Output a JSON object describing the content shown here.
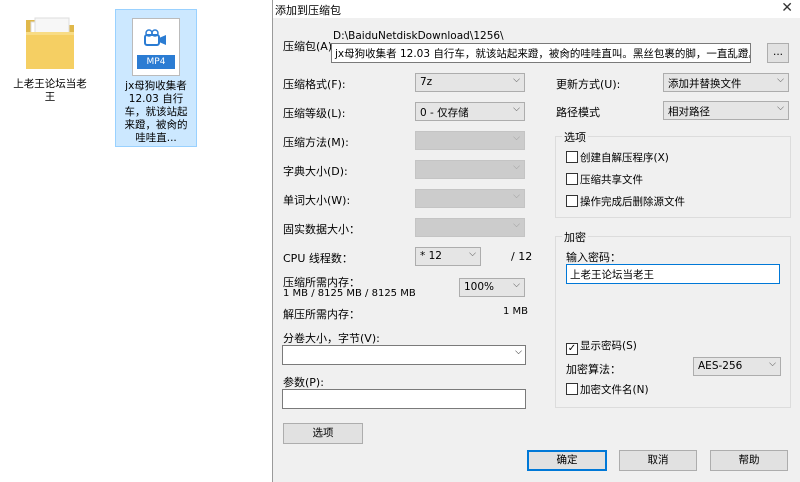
{
  "desktop": {
    "folder": {
      "label": "上老王论坛当老王"
    },
    "mp4": {
      "badge": "MP4",
      "label": "jx母狗收集者 12.03 自行车，就该站起来蹬，被肏的哇哇直..."
    }
  },
  "dialog": {
    "title": "添加到压缩包",
    "archive_label": "压缩包(A)",
    "archive_path": "D:\\BaiduNetdiskDownload\\1256\\",
    "archive_name": "jx母狗收集者 12.03 自行车，就该站起来蹬，被肏的哇哇直叫。黑丝包裹的脚，一直乱蹬。",
    "browse_label": "...",
    "format_label": "压缩格式(F):",
    "format_value": "7z",
    "level_label": "压缩等级(L):",
    "level_value": "0 - 仅存储",
    "method_label": "压缩方法(M):",
    "dict_label": "字典大小(D):",
    "word_label": "单词大小(W):",
    "solid_label": "固实数据大小：",
    "threads_label": "CPU 线程数：",
    "threads_value": "* 12",
    "threads_max": "/ 12",
    "mem_comp_label": "压缩所需内存：",
    "mem_comp_value": "1 MB / 8125 MB / 8125 MB",
    "mem_percent": "100%",
    "mem_decomp_label": "解压所需内存：",
    "mem_decomp_value": "1 MB",
    "split_label": "分卷大小，字节(V):",
    "params_label": "参数(P):",
    "options_button": "选项",
    "update_label": "更新方式(U):",
    "update_value": "添加并替换文件",
    "pathmode_label": "路径模式",
    "pathmode_value": "相对路径",
    "options_group": "选项",
    "opt_sfx": "创建自解压程序(X)",
    "opt_shared": "压缩共享文件",
    "opt_delete": "操作完成后删除源文件",
    "enc_group": "加密",
    "enc_password_label": "输入密码：",
    "enc_password_value": "上老王论坛当老王",
    "show_password": "显示密码(S)",
    "enc_method_label": "加密算法：",
    "enc_method_value": "AES-256",
    "enc_names": "加密文件名(N)",
    "ok": "确定",
    "cancel": "取消",
    "help": "帮助",
    "close_glyph": "✕",
    "check_glyph": "✓",
    "arrow_glyph": "⌵"
  }
}
